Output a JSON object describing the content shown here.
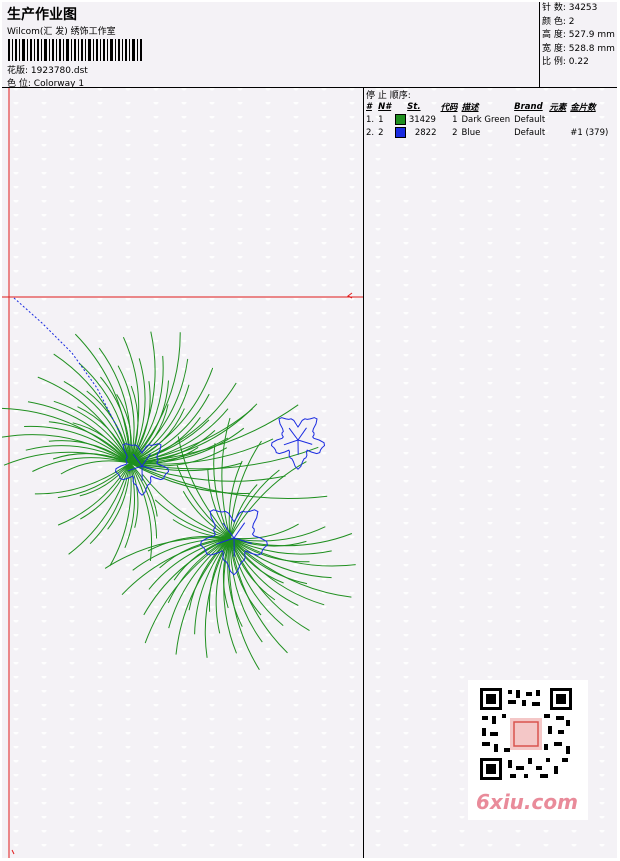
{
  "header": {
    "title": "生产作业图",
    "studio": "Wilcom(汇 发) 绣饰工作室",
    "pattern_label": "花版:",
    "pattern_value": "1923780.dst",
    "colorway_label": "色 位:",
    "colorway_value": "Colorway 1"
  },
  "stats": {
    "stitches": "针 数: 34253",
    "colors": "颜 色: 2",
    "height": "高 度: 527.9 mm",
    "width": "宽 度: 528.8 mm",
    "scale": "比 例: 0.22"
  },
  "stop_sequence": {
    "title": "停 止 顺序:",
    "headers": [
      "#",
      "N#",
      "St.",
      "代码",
      "描述",
      "Brand",
      "元素",
      "金片数"
    ],
    "rows": [
      {
        "idx": "1.",
        "n": "1",
        "color": "#1f8f1f",
        "st": "31429",
        "code": "1",
        "desc": "Dark Green",
        "brand": "Default",
        "elem": "",
        "seq": ""
      },
      {
        "idx": "2.",
        "n": "2",
        "color": "#1a2be0",
        "st": "2822",
        "code": "2",
        "desc": "Blue",
        "brand": "Default",
        "elem": "",
        "seq": "#1 (379)"
      }
    ]
  },
  "colors": {
    "green": "#1f8f1f",
    "blue": "#1a2be0",
    "guide_red": "#e11b1b"
  },
  "watermark": {
    "site": "6xiu.com"
  }
}
